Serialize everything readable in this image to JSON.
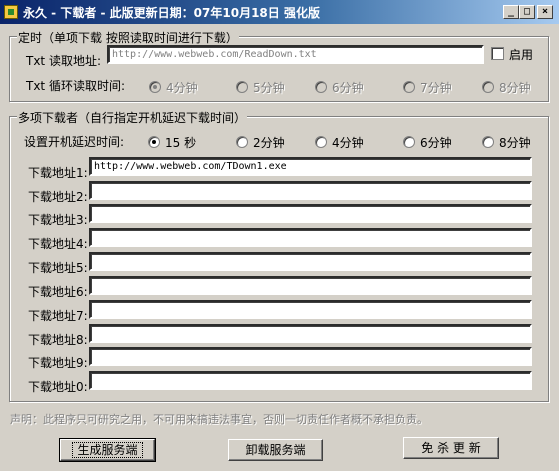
{
  "window": {
    "title": "永久 - 下载者 - 此版更新日期：07年10月18日 强化版",
    "icon": "app-icon",
    "controls": {
      "minimize": "_",
      "maximize": "□",
      "close": "×"
    }
  },
  "timer_group": {
    "legend": "定时（单项下载  按照读取时间进行下载）",
    "txt_url_label": "Txt 读取地址:",
    "txt_url_value": "http://www.webweb.com/ReadDown.txt",
    "enable_label": "启用",
    "enabled": false,
    "cycle_label": "Txt 循环读取时间:",
    "cycle_options": [
      {
        "label": "4分钟",
        "selected": true
      },
      {
        "label": "5分钟",
        "selected": false
      },
      {
        "label": "6分钟",
        "selected": false
      },
      {
        "label": "7分钟",
        "selected": false
      },
      {
        "label": "8分钟",
        "selected": false
      }
    ]
  },
  "multi_group": {
    "legend": "多项下载者（自行指定开机延迟下载时间）",
    "delay_label": "设置开机延迟时间:",
    "delay_options": [
      {
        "label": "15 秒",
        "selected": true
      },
      {
        "label": "2分钟",
        "selected": false
      },
      {
        "label": "4分钟",
        "selected": false
      },
      {
        "label": "6分钟",
        "selected": false
      },
      {
        "label": "8分钟",
        "selected": false
      }
    ],
    "downloads": [
      {
        "label": "下载地址1:",
        "value": "http://www.webweb.com/TDown1.exe"
      },
      {
        "label": "下载地址2:",
        "value": ""
      },
      {
        "label": "下载地址3:",
        "value": ""
      },
      {
        "label": "下载地址4:",
        "value": ""
      },
      {
        "label": "下载地址5:",
        "value": ""
      },
      {
        "label": "下载地址6:",
        "value": ""
      },
      {
        "label": "下载地址7:",
        "value": ""
      },
      {
        "label": "下载地址8:",
        "value": ""
      },
      {
        "label": "下载地址9:",
        "value": ""
      },
      {
        "label": "下载地址0:",
        "value": ""
      }
    ]
  },
  "disclaimer": "声明：此程序只可研究之用，不可用来搞违法事宜，否则一切责任作者概不承担负责。",
  "buttons": {
    "generate": "生成服务端",
    "uninstall": "卸载服务端",
    "anti_kill": "免 杀 更 新"
  },
  "colors": {
    "titlebar_start": "#0a246a",
    "titlebar_end": "#a6caf0",
    "face": "#d4d0c8"
  }
}
